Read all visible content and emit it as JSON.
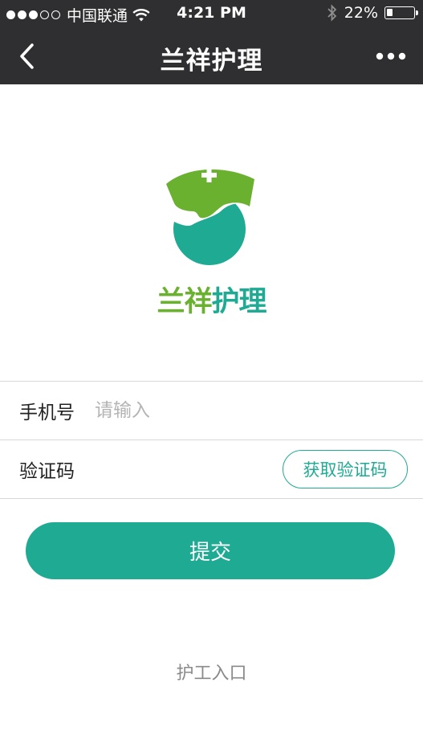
{
  "status_bar": {
    "carrier": "中国联通",
    "time": "4:21 PM",
    "battery_text": "22%",
    "battery_level": 0.22,
    "signal_bars_filled": 3,
    "signal_bars_total": 5,
    "icons": [
      "wifi-icon",
      "bluetooth-icon",
      "battery-icon"
    ]
  },
  "nav": {
    "title": "兰祥护理",
    "back_icon": "chevron-left-icon",
    "more_icon": "more-dots-icon"
  },
  "logo": {
    "text_part1": "兰祥",
    "text_part2": "护理",
    "colors": {
      "green": "#6ab130",
      "teal": "#1faa94"
    }
  },
  "form": {
    "phone_label": "手机号",
    "phone_placeholder": "请输入",
    "phone_value": "",
    "code_label": "验证码",
    "get_code_label": "获取验证码"
  },
  "submit_label": "提交",
  "worker_entry_label": "护工入口",
  "colors": {
    "accent": "#1faa94",
    "nav_bg": "#2f2f31"
  }
}
